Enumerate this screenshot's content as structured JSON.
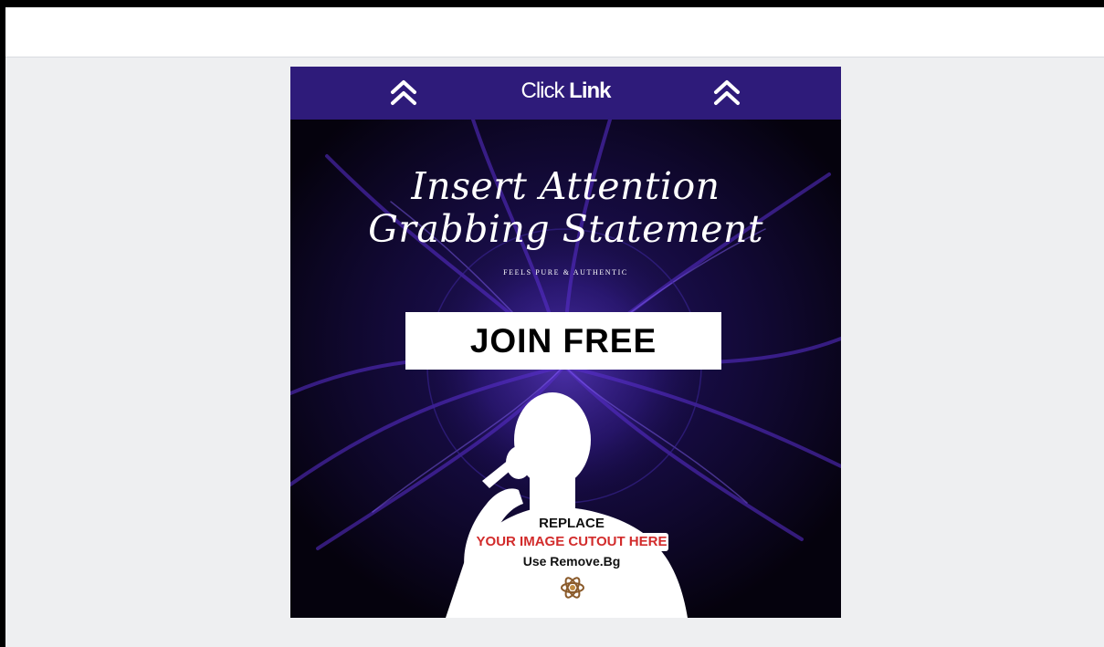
{
  "banner": {
    "cta_word1": "Click",
    "cta_word2": "Link",
    "left_icon": "double-chevron-up-icon",
    "right_icon": "double-chevron-up-icon",
    "color": "#2e1b7a"
  },
  "headline": {
    "line1": "Insert Attention",
    "line2": "Grabbing Statement"
  },
  "tagline": "FEELS PURE & AUTHENTIC",
  "join_button": {
    "label": "JOIN FREE"
  },
  "placeholder": {
    "title": "REPLACE",
    "instruction": "YOUR IMAGE CUTOUT HERE",
    "hint": "Use Remove.Bg",
    "logo_icon": "atom-icon",
    "accent": "#d22b2b"
  },
  "colors": {
    "page_background": "#eeeff1",
    "top_bar": "#ffffff",
    "design_background": "#05020d",
    "glow": "#5a2fd0"
  }
}
